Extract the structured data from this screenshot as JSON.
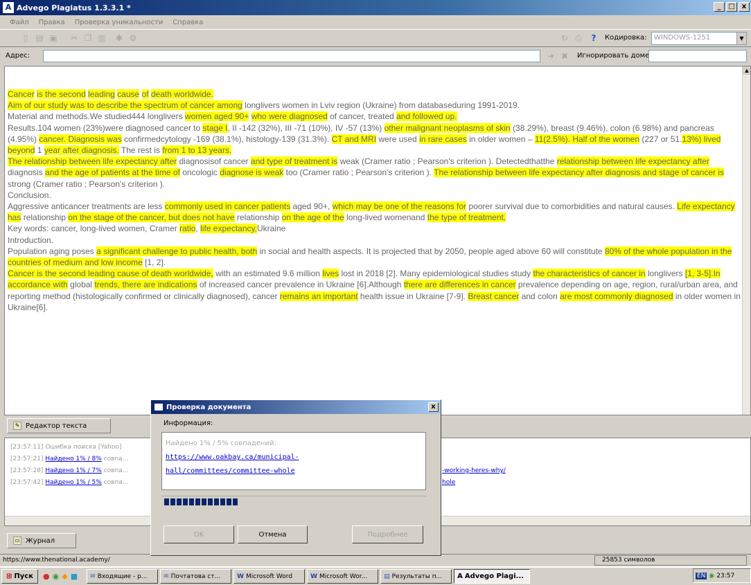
{
  "window": {
    "title": "Advego Plagiatus 1.3.3.1 *",
    "app_icon_letter": "A",
    "min": "_",
    "max": "□",
    "close": "x"
  },
  "menu": [
    "Файл",
    "Правка",
    "Проверка уникальности",
    "Справка"
  ],
  "toolbar": {
    "encoding_label": "Кодировка:",
    "encoding_value": "WINDOWS-1251"
  },
  "address": {
    "label": "Адрес:",
    "ignore_label": "Игнорировать домены:"
  },
  "editor": {
    "paragraphs": [
      [
        {
          "t": "Cancer",
          "h": 1
        },
        {
          "t": " "
        },
        {
          "t": "is the second",
          "h": 1
        },
        {
          "t": " "
        },
        {
          "t": "leading",
          "h": 1
        },
        {
          "t": " "
        },
        {
          "t": "cause",
          "h": 1
        },
        {
          "t": " "
        },
        {
          "t": "of",
          "h": 1
        },
        {
          "t": " "
        },
        {
          "t": "death worldwide.",
          "h": 1
        }
      ],
      [
        {
          "t": "Aim of our study was to describe the spectrum of cancer among",
          "h": 1
        },
        {
          "t": " longlivers women in Lviv region (Ukraine) from databaseduring 1991-2019."
        }
      ],
      [
        {
          "t": "Material and methods.We studied444 longlivers "
        },
        {
          "t": "women aged 90+",
          "h": 1
        },
        {
          "t": " "
        },
        {
          "t": "who were diagnosed",
          "h": 1
        },
        {
          "t": " of cancer, treated "
        },
        {
          "t": "and followed up.",
          "h": 1
        }
      ],
      [
        {
          "t": "Results.104 women (23%)were diagnosed cancer to "
        },
        {
          "t": "stage I",
          "h": 1
        },
        {
          "t": ", II -142 (32%), III -71 (10%), IV -57 (13%) "
        },
        {
          "t": "other malignant neoplasms of skin",
          "h": 1
        },
        {
          "t": " (38.29%), breast (9.46%), colon (6.98%) and pancreas (4.95%) "
        },
        {
          "t": "cancer. Diagnosis was",
          "h": 1
        },
        {
          "t": " confirmedcytology -169 (38.1%), histology-139 (31.3%). "
        },
        {
          "t": "CT and MRI",
          "h": 1
        },
        {
          "t": " were used "
        },
        {
          "t": "in rare cases",
          "h": 1
        },
        {
          "t": " in older women – "
        },
        {
          "t": "11(2.5%). Half of the women",
          "h": 1
        },
        {
          "t": " (227 or 51."
        },
        {
          "t": "13%) lived beyond",
          "h": 1
        },
        {
          "t": " 1 "
        },
        {
          "t": "year after diagnosis.",
          "h": 1
        },
        {
          "t": " The rest is "
        },
        {
          "t": "from 1 to 13 years.",
          "h": 1
        }
      ],
      [
        {
          "t": "The relationship between life expectancy after",
          "h": 1
        },
        {
          "t": " diagnosisof cancer "
        },
        {
          "t": "and type of treatment is",
          "h": 1
        },
        {
          "t": " weak (Cramer ratio ; Pearson's criterion  ). Detectedthatthe "
        },
        {
          "t": "relationship between life expectancy after",
          "h": 1
        },
        {
          "t": " diagnosis "
        },
        {
          "t": "and the age of patients at the time of",
          "h": 1
        },
        {
          "t": " oncologic "
        },
        {
          "t": "diagnose is weak",
          "h": 1
        },
        {
          "t": " too (Cramer ratio  ; Pearson's criterion  ). "
        },
        {
          "t": "The relationship between life expectancy after diagnosis and stage of cancer is",
          "h": 1
        },
        {
          "t": " strong (Cramer ratio ; Pearson's criterion  )."
        }
      ],
      [
        {
          "t": "Conclusion."
        }
      ],
      [
        {
          "t": "Aggressive anticancer treatments are less "
        },
        {
          "t": "commonly used in cancer patients",
          "h": 1
        },
        {
          "t": " aged 90+, "
        },
        {
          "t": "which may be one of the reasons for",
          "h": 1
        },
        {
          "t": " poorer survival due to comorbidities and natural causes. "
        },
        {
          "t": "Life expectancy has",
          "h": 1
        },
        {
          "t": " relationship "
        },
        {
          "t": "on the stage of the cancer, but does not have",
          "h": 1
        },
        {
          "t": " relationship "
        },
        {
          "t": "on the age of the",
          "h": 1
        },
        {
          "t": " long-lived womenand "
        },
        {
          "t": "the type of treatment.",
          "h": 1
        }
      ],
      [
        {
          "t": "Key words: cancer, long-lived women, Cramer "
        },
        {
          "t": "ratio",
          "h": 1
        },
        {
          "t": ", "
        },
        {
          "t": "life expectancy,",
          "h": 1
        },
        {
          "t": "Ukraine"
        }
      ],
      [
        {
          "t": "Introduction."
        }
      ],
      [
        {
          "t": "Population aging poses "
        },
        {
          "t": "a significant challenge to public health, both",
          "h": 1
        },
        {
          "t": " in social and health aspects. It is projected that by 2050, people aged above 60 will constitute "
        },
        {
          "t": "80% of the whole population in the countries of medium and low income",
          "h": 1
        },
        {
          "t": " [1, 2]."
        }
      ],
      [
        {
          "t": "Cancer is the second leading cause of death worldwide,",
          "h": 1
        },
        {
          "t": " with an estimated 9.6 million "
        },
        {
          "t": "lives",
          "h": 1
        },
        {
          "t": " lost in 2018 [2]. Many epidemiological studies study "
        },
        {
          "t": "the characteristics of cancer in",
          "h": 1
        },
        {
          "t": " longlivers "
        },
        {
          "t": "[1, 3-5].In accordance with",
          "h": 1
        },
        {
          "t": " global "
        },
        {
          "t": "trends, there are indications",
          "h": 1
        },
        {
          "t": " of increased cancer prevalence in Ukraine [6].Although "
        },
        {
          "t": "there are differences in cancer",
          "h": 1
        },
        {
          "t": " prevalence depending on age, region, rural/urban area, and reporting method (histologically confirmed or clinically diagnosed), cancer "
        },
        {
          "t": "remains an important",
          "h": 1
        },
        {
          "t": " health issue in Ukraine [7-9]. "
        },
        {
          "t": "Breast cancer",
          "h": 1
        },
        {
          "t": " and colon "
        },
        {
          "t": "are most commonly diagnosed",
          "h": 1
        },
        {
          "t": " in older women in Ukraine[6]."
        }
      ]
    ]
  },
  "tabs": {
    "editor": "Редактор текста",
    "log": "Журнал"
  },
  "log": {
    "lines": [
      {
        "ts": "[23:57:11]",
        "text": "Ошибка поиска [Yahoo]",
        "link": "",
        "tail": ""
      },
      {
        "ts": "[23:57:21]",
        "text": "",
        "link": "Найдено 1% / 8%",
        "tail": " совпа..."
      },
      {
        "ts": "[23:57:28]",
        "text": "",
        "link": "Найдено 1% / 7%",
        "tail": " совпа..."
      },
      {
        "ts": "[23:57:42]",
        "text": "",
        "link": "Найдено 1% / 5%",
        "tail": " совпа..."
      }
    ],
    "url_tail_1": "-working-heres-why/",
    "url_tail_2": "hole"
  },
  "status": {
    "url": "https://www.thenational.academy/",
    "char_count": "25853 символов"
  },
  "dialog": {
    "title": "Проверка документа",
    "info_label": "Информация:",
    "found_text": "Найдено 1% / 5% совпадений:",
    "url_line1": "https://www.oakbay.ca/municipal-",
    "url_line2": "hall/committees/committee-whole",
    "progress": 0.28,
    "ok_label": "OK",
    "cancel_label": "Отмена",
    "details_label": "Подробнее"
  },
  "taskbar": {
    "start": "Пуск",
    "items": [
      "Входящие - p...",
      "Почтатова ст...",
      "Microsoft Word",
      "Microsoft Wor...",
      "Результаты п..."
    ],
    "active": "Advego Plagi...",
    "clock": "23:57",
    "lang": "EN"
  }
}
